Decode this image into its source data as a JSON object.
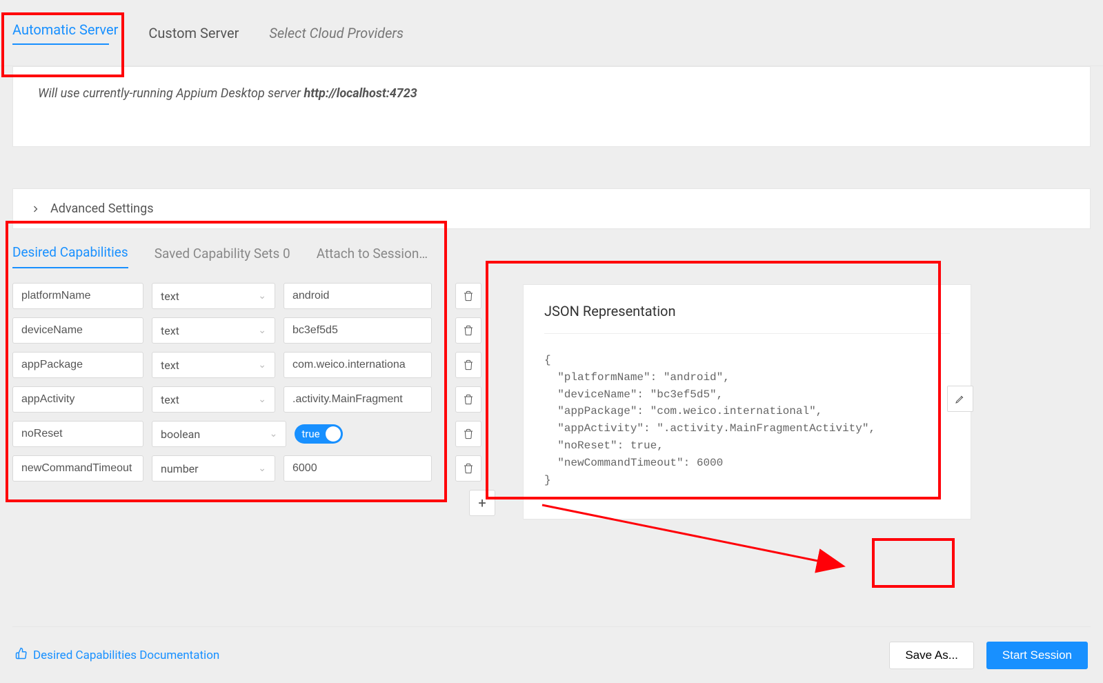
{
  "top_tabs": {
    "automatic": "Automatic Server",
    "custom": "Custom Server",
    "cloud": "Select Cloud Providers"
  },
  "server_info": {
    "prefix": "Will use currently-running Appium Desktop server ",
    "host": "http://localhost:4723"
  },
  "advanced_label": "Advanced Settings",
  "inner_tabs": {
    "desired": "Desired Capabilities",
    "saved": "Saved Capability Sets 0",
    "attach": "Attach to Session…"
  },
  "capabilities": [
    {
      "name": "platformName",
      "type": "text",
      "value": "android"
    },
    {
      "name": "deviceName",
      "type": "text",
      "value": "bc3ef5d5"
    },
    {
      "name": "appPackage",
      "type": "text",
      "value": "com.weico.internationa"
    },
    {
      "name": "appActivity",
      "type": "text",
      "value": ".activity.MainFragment"
    },
    {
      "name": "noReset",
      "type": "boolean",
      "value": "true"
    },
    {
      "name": "newCommandTimeout",
      "type": "number",
      "value": "6000"
    }
  ],
  "json_title": "JSON Representation",
  "json_body": "{\n  \"platformName\": \"android\",\n  \"deviceName\": \"bc3ef5d5\",\n  \"appPackage\": \"com.weico.international\",\n  \"appActivity\": \".activity.MainFragmentActivity\",\n  \"noReset\": true,\n  \"newCommandTimeout\": 6000\n}",
  "footer": {
    "doc": "Desired Capabilities Documentation",
    "save": "Save As...",
    "start": "Start Session"
  }
}
